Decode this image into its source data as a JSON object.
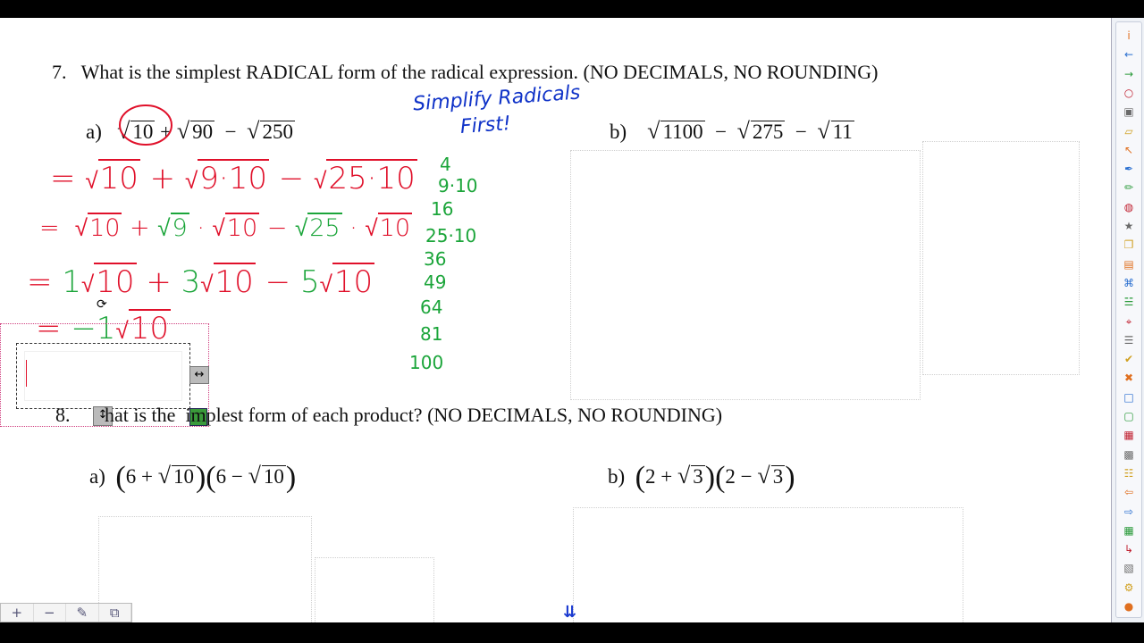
{
  "q7": {
    "number": "7.",
    "text": "What is the simplest RADICAL  form of the radical expression.  (NO DECIMALS, NO ROUNDING)",
    "a_label": "a)",
    "a_r1": "10",
    "a_op1": "+",
    "a_r2": "90",
    "a_op2": "−",
    "a_r3": "250",
    "b_label": "b)",
    "b_r1": "1100",
    "b_op1": "−",
    "b_r2": "275",
    "b_op2": "−",
    "b_r3": "11"
  },
  "q8": {
    "number": "8.",
    "text_pre": "hat is the",
    "text_post": "implest form of each product?  (NO DECIMALS, NO ROUNDING)",
    "a_label": "a)",
    "a_f1_n": "6",
    "a_f1_op": "+",
    "a_f1_r": "10",
    "a_f2_n": "6",
    "a_f2_op": "−",
    "a_f2_r": "10",
    "b_label": "b)",
    "b_f1_n": "2",
    "b_f1_op": "+",
    "b_f1_r": "3",
    "b_f2_n": "2",
    "b_f2_op": "−",
    "b_f2_r": "3"
  },
  "annotation": {
    "note_line1": "Simplify Radicals",
    "note_line2": "First!",
    "line1_eq": "=",
    "line1_r1": "10",
    "line1_op1": "+",
    "line1_r2": "9·10",
    "line1_op2": "−",
    "line1_r3": "25·10",
    "line2_eq": "=",
    "line2_r1": "10",
    "line2_op1": "+",
    "line2_r2": "9",
    "line2_dot1": "·",
    "line2_r3": "10",
    "line2_op2": "−",
    "line2_r4": "25",
    "line2_dot2": "·",
    "line2_r5": "10",
    "line3_eq": "=",
    "line3_c1": "1",
    "line3_r1": "10",
    "line3_op1": "+",
    "line3_c2": "3",
    "line3_r2": "10",
    "line3_op2": "−",
    "line3_c3": "5",
    "line3_r3": "10",
    "line4_eq": "=",
    "line4_c": "−1",
    "line4_r": "10",
    "squares": [
      "4",
      "9·10",
      "16",
      "25·10",
      "36",
      "49",
      "64",
      "81",
      "100"
    ]
  },
  "zoom": {
    "zoom_in": "+",
    "zoom_out": "−",
    "edit": "✎",
    "fit": "⧉"
  },
  "nav": {
    "page_down": "⇊"
  },
  "toolbar": {
    "icons": [
      "i",
      "←",
      "→",
      "○",
      "▣",
      "▱",
      "↖",
      "✒",
      "✏",
      "◍",
      "★",
      "❐",
      "▤",
      "⌘",
      "☱",
      "⌖",
      "☰",
      "✔",
      "✖",
      "□",
      "▢",
      "▦",
      "▩",
      "☷",
      "⇦",
      "⇨",
      "▦",
      "↳",
      "▧",
      "⚙",
      "●"
    ]
  },
  "colors": {
    "red_ink": "#e0102a",
    "green_ink": "#1ba53a",
    "blue_ink": "#1033c8"
  }
}
